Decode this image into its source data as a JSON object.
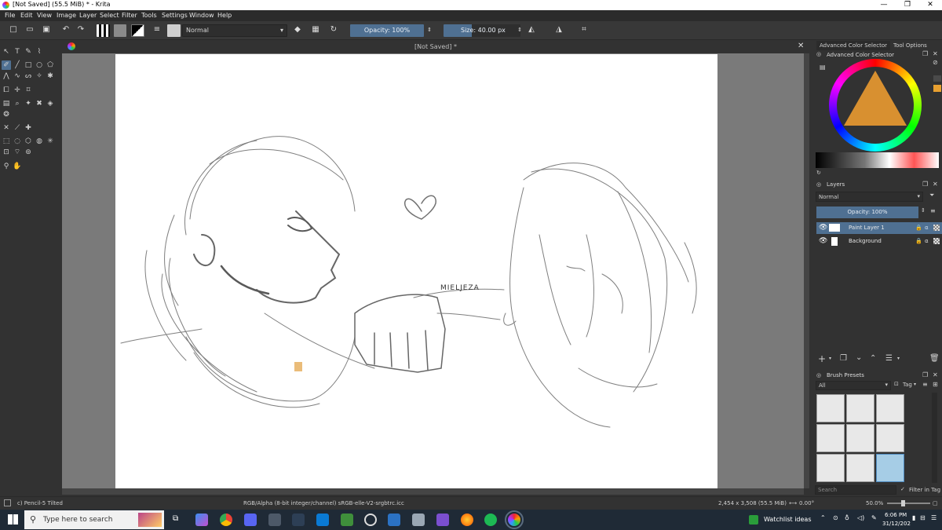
{
  "window": {
    "title": "[Not Saved]  (55.5 MiB)  * - Krita",
    "controls": [
      "—",
      "❐",
      "✕"
    ]
  },
  "menu": [
    "File",
    "Edit",
    "View",
    "Image",
    "Layer",
    "Select",
    "Filter",
    "Tools",
    "Settings",
    "Window",
    "Help"
  ],
  "toolbar": {
    "blend_mode": "Normal",
    "opacity_label": "Opacity: 100%",
    "opacity_value": 1.0,
    "size_label": "Size: 40.00 px"
  },
  "document": {
    "tab_title": "[Not Saved]  *",
    "sketch_text": "MIELJEZA"
  },
  "dock": {
    "color_tab": "Advanced Color Selector",
    "tool_options_tab": "Tool Options",
    "color_panel_title": "Advanced Color Selector",
    "layers_title": "Layers",
    "layers_blend": "Normal",
    "layers_opacity": "Opacity:  100%",
    "layers": [
      {
        "name": "Paint Layer 1",
        "selected": true
      },
      {
        "name": "Background",
        "selected": false
      }
    ],
    "brush_presets_title": "Brush Presets",
    "brush_filter": "All",
    "brush_tag": "Tag",
    "search_placeholder": "Search",
    "filter_in_tag": "Filter in Tag"
  },
  "status": {
    "brush": "c) Pencil-5 Tilted",
    "color_space": "RGB/Alpha (8-bit integer/channel)  sRGB-elle-V2-srgbtrc.icc",
    "dimensions": "2,454 x 3,508 (55.5 MiB)",
    "rotation": "0.00°",
    "zoom": "50.0%"
  },
  "taskbar": {
    "search_placeholder": "Type here to search",
    "watchlist": "Watchlist ideas",
    "time": "6:06 PM",
    "date": "31/12/202"
  },
  "colors": {
    "accent": "#4f7092",
    "panel": "#323232",
    "taskbar": "#1f2a36"
  }
}
